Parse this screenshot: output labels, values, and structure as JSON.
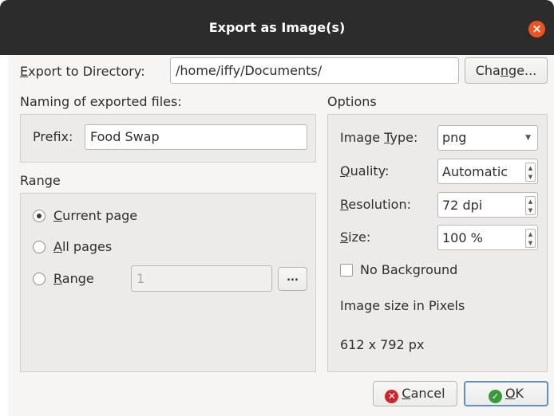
{
  "window": {
    "title": "Export as Image(s)",
    "close_glyph": "×"
  },
  "directory": {
    "label_pre": "",
    "label_ul": "E",
    "label_post": "xport to Directory:",
    "value": "/home/iffy/Documents/",
    "change_pre": "Cha",
    "change_ul": "n",
    "change_post": "ge..."
  },
  "naming": {
    "heading": "Naming of exported files:",
    "prefix_label": "Prefix:",
    "prefix_value": "Food Swap"
  },
  "range": {
    "heading": "Range",
    "current_ul": "C",
    "current_rest": "urrent page",
    "all_ul": "A",
    "all_rest": "ll pages",
    "range_ul": "R",
    "range_rest": "ange",
    "range_value": "1",
    "browse_label": "...",
    "selected": "current"
  },
  "options": {
    "heading": "Options",
    "image_type_pre": "Image ",
    "image_type_ul": "T",
    "image_type_post": "ype:",
    "image_type_value": "png",
    "quality_ul": "Q",
    "quality_rest": "uality:",
    "quality_value": "Automatic",
    "resolution_ul": "R",
    "resolution_rest": "esolution:",
    "resolution_value": "72 dpi",
    "size_ul": "S",
    "size_rest": "ize:",
    "size_value": "100 %",
    "no_background_label": "No Background",
    "no_background_checked": false,
    "pixels_heading": "Image size in Pixels",
    "pixels_value": "612 x 792 px"
  },
  "buttons": {
    "cancel_ul": "C",
    "cancel_rest": "ancel",
    "ok_ul": "O",
    "ok_rest": "K"
  },
  "colors": {
    "titlebar": "#2c2c2c",
    "close": "#e95420",
    "cancel_icon": "#d0262b",
    "ok_icon": "#3a9a3a",
    "ok_border": "#5f8fc9"
  },
  "icons": {
    "cancel": "cancel-icon",
    "ok": "ok-icon",
    "close": "close-icon"
  }
}
